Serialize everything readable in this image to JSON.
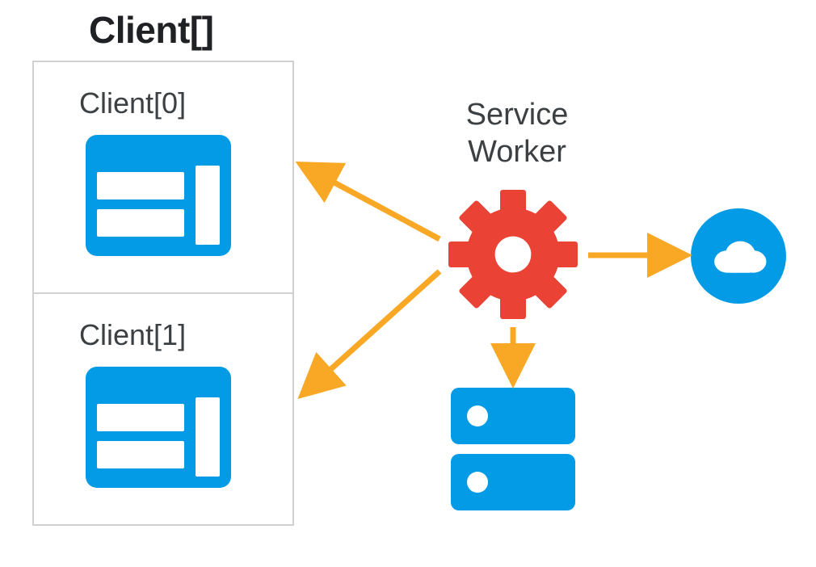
{
  "title": "Client[]",
  "clients": {
    "items": [
      {
        "label": "Client[0]"
      },
      {
        "label": "Client[1]"
      }
    ]
  },
  "service_worker": {
    "label_line1": "Service",
    "label_line2": "Worker"
  },
  "colors": {
    "blue": "#039be5",
    "red": "#ea4335",
    "orange": "#f9a825",
    "text": "#3c4043"
  },
  "arrows": [
    {
      "from": "service-worker",
      "to": "client-0",
      "bidirectional": false
    },
    {
      "from": "service-worker",
      "to": "client-1",
      "bidirectional": false
    },
    {
      "from": "service-worker",
      "to": "server",
      "bidirectional": false
    },
    {
      "from": "service-worker",
      "to": "cloud",
      "bidirectional": false
    }
  ],
  "nodes": {
    "server": "server-icon",
    "cloud": "cloud-icon",
    "gear": "gear-icon",
    "browser": "browser-window-icon"
  }
}
